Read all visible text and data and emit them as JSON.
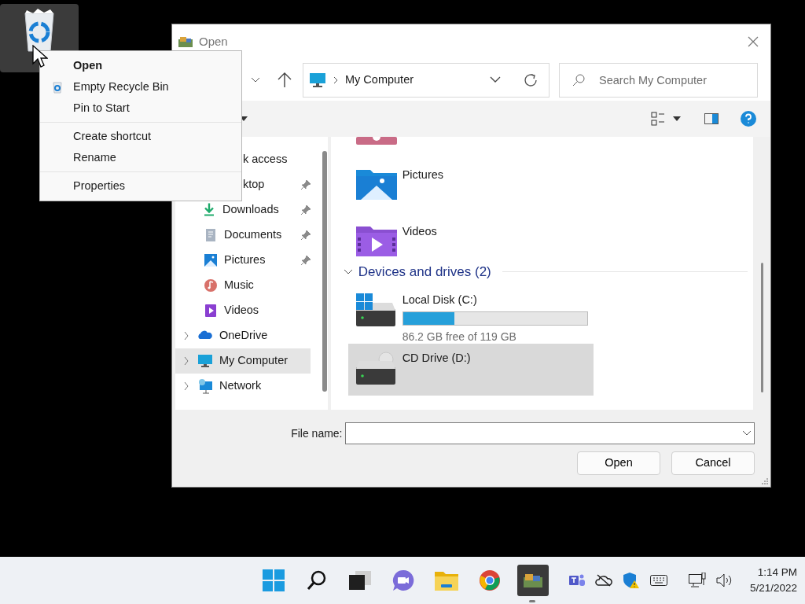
{
  "desktop_icon": {
    "selected": true
  },
  "dialog": {
    "title": "Open",
    "address": {
      "path": "My Computer"
    },
    "search": {
      "placeholder": "Search My Computer"
    },
    "nav": [
      {
        "label": "k access",
        "kind": "quick",
        "clipped": true,
        "pinned": false,
        "selected": false
      },
      {
        "label": "ktop",
        "kind": "quick",
        "clipped": true,
        "pinned": true,
        "selected": false
      },
      {
        "label": "Downloads",
        "kind": "quick",
        "clipped": false,
        "pinned": true,
        "selected": false
      },
      {
        "label": "Documents",
        "kind": "quick",
        "clipped": false,
        "pinned": true,
        "selected": false
      },
      {
        "label": "Pictures",
        "kind": "quick",
        "clipped": false,
        "pinned": true,
        "selected": false
      },
      {
        "label": "Music",
        "kind": "quick",
        "clipped": false,
        "pinned": false,
        "selected": false
      },
      {
        "label": "Videos",
        "kind": "quick",
        "clipped": false,
        "pinned": false,
        "selected": false
      },
      {
        "label": "OneDrive",
        "kind": "root",
        "pinned": false,
        "selected": false
      },
      {
        "label": "My Computer",
        "kind": "root",
        "pinned": false,
        "selected": true
      },
      {
        "label": "Network",
        "kind": "root",
        "pinned": false,
        "selected": false
      }
    ],
    "folders": [
      {
        "label": "Pictures"
      },
      {
        "label": "Videos"
      }
    ],
    "group": {
      "label": "Devices and drives (2)",
      "expanded": true
    },
    "drives": [
      {
        "name": "Local Disk (C:)",
        "kind": "disk",
        "level": 0.28,
        "reading": "86.2 GB free of 119 GB",
        "selected": false
      },
      {
        "name": "CD Drive (D:)",
        "kind": "cd",
        "selected": true
      }
    ],
    "file_name": {
      "label": "File name:"
    },
    "buttons": [
      "Open",
      "Cancel"
    ]
  },
  "context_menu": {
    "groups": [
      {
        "items": [
          {
            "label": "Open",
            "default": true,
            "kind": "plain"
          },
          {
            "label": "Empty Recycle Bin",
            "default": false,
            "kind": "icon"
          },
          {
            "label": "Pin to Start",
            "default": false,
            "kind": "plain"
          }
        ]
      },
      {
        "items": [
          {
            "label": "Create shortcut",
            "default": false,
            "kind": "plain"
          },
          {
            "label": "Rename",
            "default": false,
            "kind": "plain"
          }
        ]
      },
      {
        "items": [
          {
            "label": "Properties",
            "default": false,
            "kind": "plain"
          }
        ]
      }
    ]
  },
  "taskbar": {
    "apps": [
      {
        "running": false
      },
      {
        "running": false
      },
      {
        "running": false
      },
      {
        "running": false
      },
      {
        "running": false
      },
      {
        "running": false
      },
      {
        "running": true
      }
    ],
    "clock": {
      "time": "1:14 PM",
      "date": "5/21/2022"
    }
  }
}
